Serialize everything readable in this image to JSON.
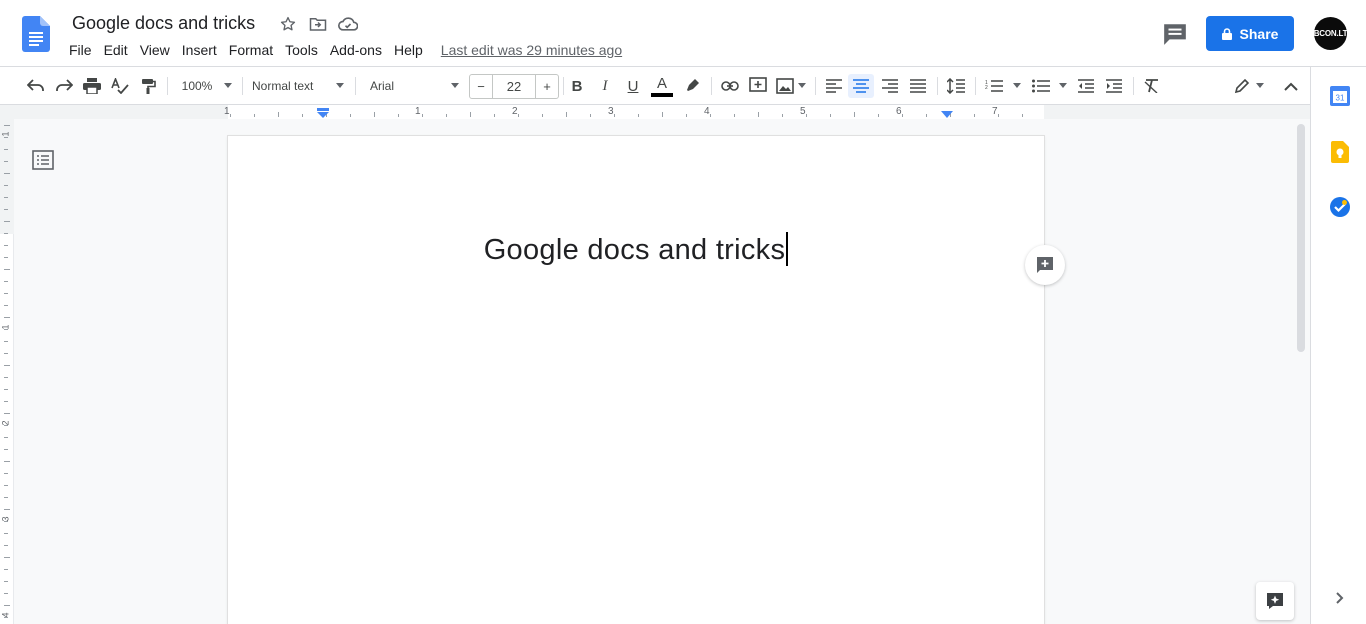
{
  "app": {
    "title": "Google docs and tricks",
    "last_edit": "Last edit was 29 minutes ago",
    "share_label": "Share",
    "avatar_text": "BCON.LT"
  },
  "menu": [
    "File",
    "Edit",
    "View",
    "Insert",
    "Format",
    "Tools",
    "Add-ons",
    "Help"
  ],
  "toolbar": {
    "zoom": "100%",
    "style": "Normal text",
    "font": "Arial",
    "font_size": "22",
    "minus": "−",
    "plus": "+"
  },
  "ruler": {
    "labels": [
      "1",
      "1",
      "2",
      "3",
      "4",
      "5",
      "6",
      "7"
    ]
  },
  "vruler": {
    "labels": [
      "1",
      "1",
      "2",
      "3",
      "4"
    ]
  },
  "document": {
    "heading": "Google docs and tricks"
  },
  "colors": {
    "accent": "#1a73e8",
    "keep": "#fbbc04",
    "text_color_bar": "#000000"
  },
  "icons": {
    "calendar_label": "31"
  }
}
